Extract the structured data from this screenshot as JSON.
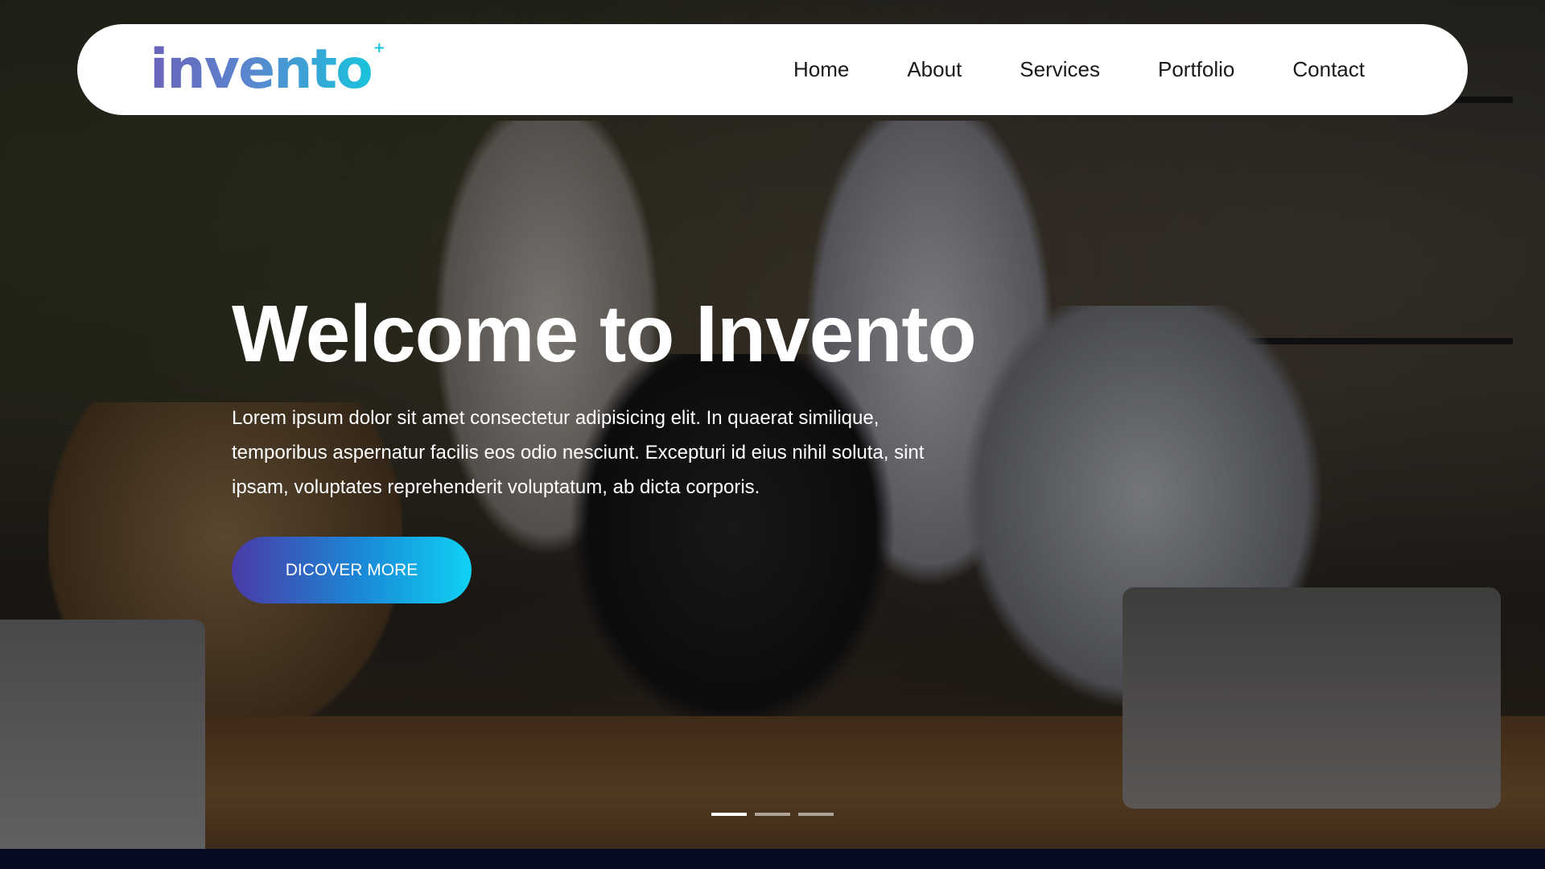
{
  "brand": {
    "logo_text": "invento",
    "logo_mark": "+"
  },
  "nav": {
    "items": [
      {
        "label": "Home"
      },
      {
        "label": "About"
      },
      {
        "label": "Services"
      },
      {
        "label": "Portfolio"
      },
      {
        "label": "Contact"
      }
    ]
  },
  "hero": {
    "title": "Welcome to Invento",
    "description": "Lorem ipsum dolor sit amet consectetur adipisicing elit. In quaerat similique, temporibus aspernatur facilis eos odio nesciunt. Excepturi id eius nihil soluta, sint ipsam, voluptates reprehenderit voluptatum, ab dicta corporis.",
    "cta_label": "DICOVER MORE",
    "background": "office-team-photo"
  },
  "slider": {
    "slide_count": 3,
    "active_index": 0
  },
  "colors": {
    "accent_start": "#4a3aa7",
    "accent_end": "#0fd2f4",
    "footer_bg": "#070b24",
    "navbar_bg": "#ffffff"
  }
}
